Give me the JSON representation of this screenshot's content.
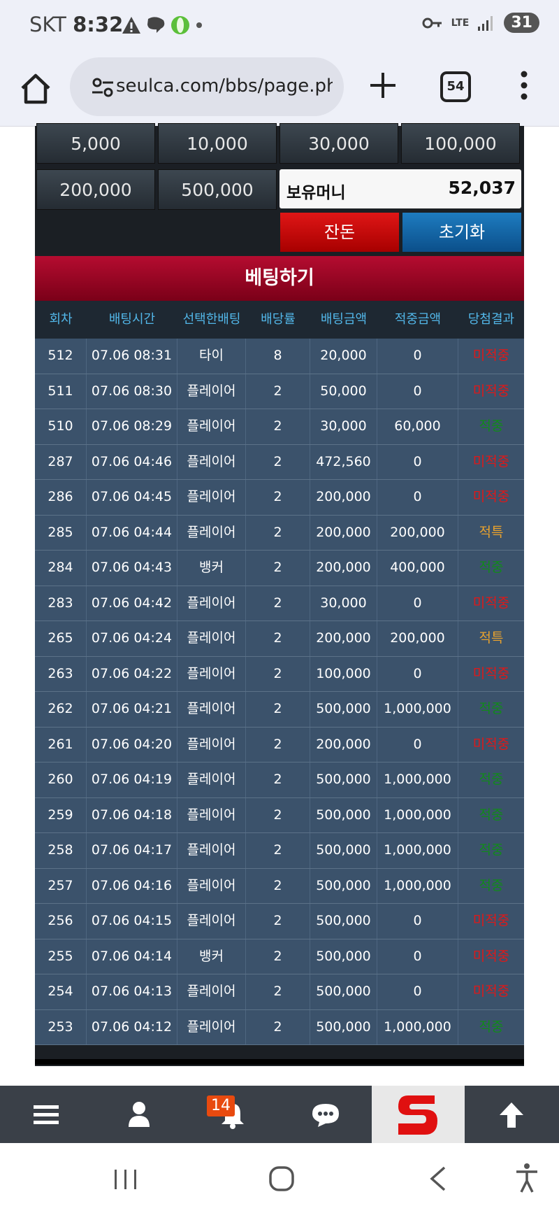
{
  "status_bar": {
    "carrier": "SKT",
    "time": "8:32",
    "network": "LTE",
    "battery": "31"
  },
  "browser": {
    "url": "seulca.com/bbs/page.php",
    "tab_count": "54"
  },
  "chips": [
    "5,000",
    "10,000",
    "30,000",
    "100,000",
    "200,000",
    "500,000"
  ],
  "balance": {
    "label": "보유머니",
    "value": "52,037"
  },
  "buttons": {
    "change": "잔돈",
    "reset": "초기화"
  },
  "bet_header": "베팅하기",
  "columns": [
    "회차",
    "배팅시간",
    "선택한배팅",
    "배당률",
    "배팅금액",
    "적중금액",
    "당첨결과"
  ],
  "rows": [
    {
      "round": "512",
      "time": "07.06 08:31",
      "pick": "타이",
      "odds": "8",
      "bet": "20,000",
      "win": "0",
      "result": "미적중",
      "type": "miss"
    },
    {
      "round": "511",
      "time": "07.06 08:30",
      "pick": "플레이어",
      "odds": "2",
      "bet": "50,000",
      "win": "0",
      "result": "미적중",
      "type": "miss"
    },
    {
      "round": "510",
      "time": "07.06 08:29",
      "pick": "플레이어",
      "odds": "2",
      "bet": "30,000",
      "win": "60,000",
      "result": "적중",
      "type": "hit"
    },
    {
      "round": "287",
      "time": "07.06 04:46",
      "pick": "플레이어",
      "odds": "2",
      "bet": "472,560",
      "win": "0",
      "result": "미적중",
      "type": "miss"
    },
    {
      "round": "286",
      "time": "07.06 04:45",
      "pick": "플레이어",
      "odds": "2",
      "bet": "200,000",
      "win": "0",
      "result": "미적중",
      "type": "miss"
    },
    {
      "round": "285",
      "time": "07.06 04:44",
      "pick": "플레이어",
      "odds": "2",
      "bet": "200,000",
      "win": "200,000",
      "result": "적특",
      "type": "spec"
    },
    {
      "round": "284",
      "time": "07.06 04:43",
      "pick": "뱅커",
      "odds": "2",
      "bet": "200,000",
      "win": "400,000",
      "result": "적중",
      "type": "hit"
    },
    {
      "round": "283",
      "time": "07.06 04:42",
      "pick": "플레이어",
      "odds": "2",
      "bet": "30,000",
      "win": "0",
      "result": "미적중",
      "type": "miss"
    },
    {
      "round": "265",
      "time": "07.06 04:24",
      "pick": "플레이어",
      "odds": "2",
      "bet": "200,000",
      "win": "200,000",
      "result": "적특",
      "type": "spec"
    },
    {
      "round": "263",
      "time": "07.06 04:22",
      "pick": "플레이어",
      "odds": "2",
      "bet": "100,000",
      "win": "0",
      "result": "미적중",
      "type": "miss"
    },
    {
      "round": "262",
      "time": "07.06 04:21",
      "pick": "플레이어",
      "odds": "2",
      "bet": "500,000",
      "win": "1,000,000",
      "result": "적중",
      "type": "hit"
    },
    {
      "round": "261",
      "time": "07.06 04:20",
      "pick": "플레이어",
      "odds": "2",
      "bet": "200,000",
      "win": "0",
      "result": "미적중",
      "type": "miss"
    },
    {
      "round": "260",
      "time": "07.06 04:19",
      "pick": "플레이어",
      "odds": "2",
      "bet": "500,000",
      "win": "1,000,000",
      "result": "적중",
      "type": "hit"
    },
    {
      "round": "259",
      "time": "07.06 04:18",
      "pick": "플레이어",
      "odds": "2",
      "bet": "500,000",
      "win": "1,000,000",
      "result": "적중",
      "type": "hit"
    },
    {
      "round": "258",
      "time": "07.06 04:17",
      "pick": "플레이어",
      "odds": "2",
      "bet": "500,000",
      "win": "1,000,000",
      "result": "적중",
      "type": "hit"
    },
    {
      "round": "257",
      "time": "07.06 04:16",
      "pick": "플레이어",
      "odds": "2",
      "bet": "500,000",
      "win": "1,000,000",
      "result": "적중",
      "type": "hit"
    },
    {
      "round": "256",
      "time": "07.06 04:15",
      "pick": "플레이어",
      "odds": "2",
      "bet": "500,000",
      "win": "0",
      "result": "미적중",
      "type": "miss"
    },
    {
      "round": "255",
      "time": "07.06 04:14",
      "pick": "뱅커",
      "odds": "2",
      "bet": "500,000",
      "win": "0",
      "result": "미적중",
      "type": "miss"
    },
    {
      "round": "254",
      "time": "07.06 04:13",
      "pick": "플레이어",
      "odds": "2",
      "bet": "500,000",
      "win": "0",
      "result": "미적중",
      "type": "miss"
    },
    {
      "round": "253",
      "time": "07.06 04:12",
      "pick": "플레이어",
      "odds": "2",
      "bet": "500,000",
      "win": "1,000,000",
      "result": "적중",
      "type": "hit"
    }
  ],
  "bottom_nav": {
    "notification_count": "14"
  },
  "colors": {
    "header_red": "#a3082a",
    "row_bg": "#3b526b",
    "col_head_text": "#52b7e9",
    "miss": "#e01818",
    "hit": "#118a1a",
    "special": "#e8a22e"
  }
}
